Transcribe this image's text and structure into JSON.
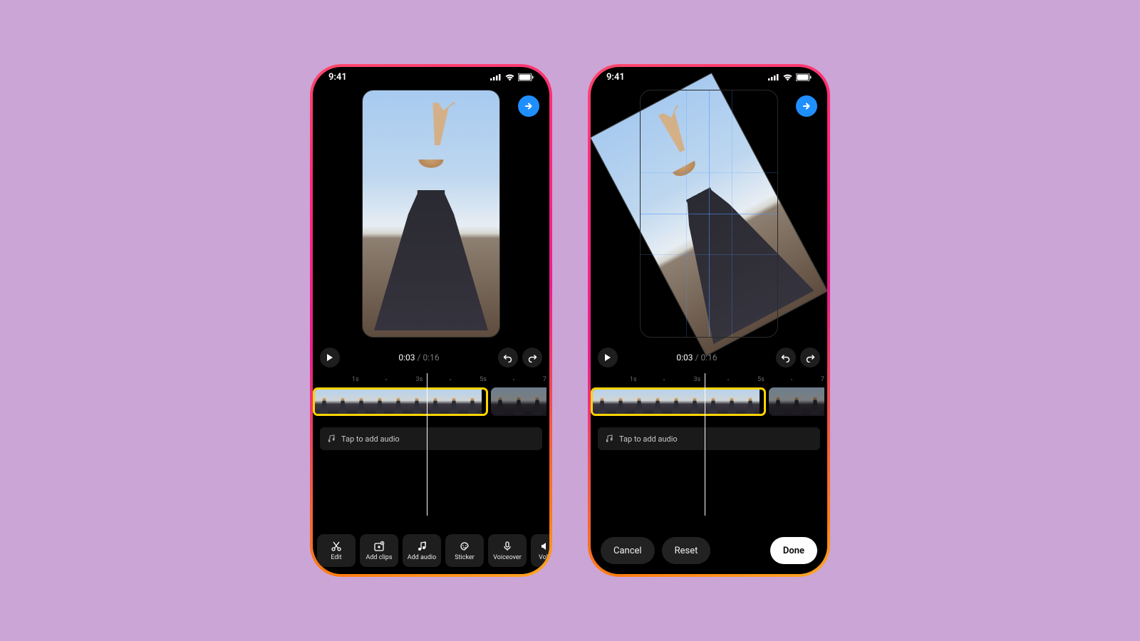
{
  "status": {
    "time": "9:41"
  },
  "playback": {
    "current": "0:03",
    "duration": "0:16"
  },
  "ruler": {
    "marks": [
      "1s",
      "3s",
      "5s",
      "7"
    ]
  },
  "audio": {
    "prompt": "Tap to add audio"
  },
  "tools": {
    "edit": "Edit",
    "add_clips": "Add clips",
    "add_audio": "Add audio",
    "sticker": "Sticker",
    "voiceover": "Voiceover",
    "volume": "Volu"
  },
  "actions": {
    "cancel": "Cancel",
    "reset": "Reset",
    "done": "Done"
  }
}
